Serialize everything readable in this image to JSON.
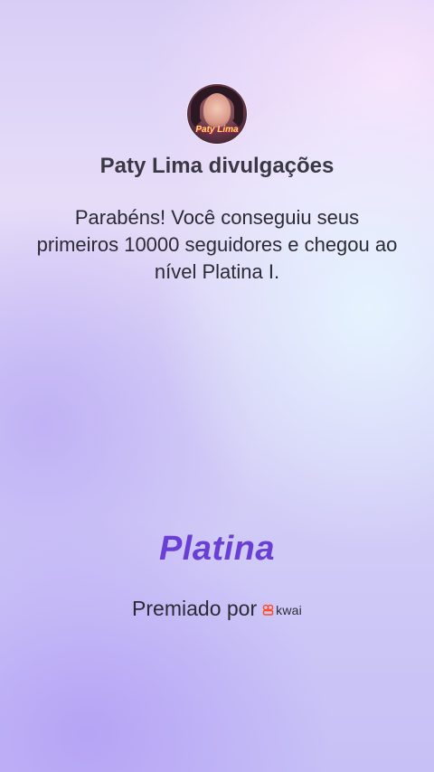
{
  "profile": {
    "name": "Paty Lima divulgações",
    "avatar_caption": "Paty Lima"
  },
  "message": "Parabéns! Você conseguiu seus primeiros 10000 seguidores e chegou ao nível Platina I.",
  "badge": {
    "level": "Platina"
  },
  "awarded": {
    "prefix": "Premiado por",
    "brand": "kwai",
    "brand_icon": "kwai-logo-icon",
    "brand_color": "#ff4b1f"
  },
  "colors": {
    "level_text": "#6a3fd6"
  }
}
